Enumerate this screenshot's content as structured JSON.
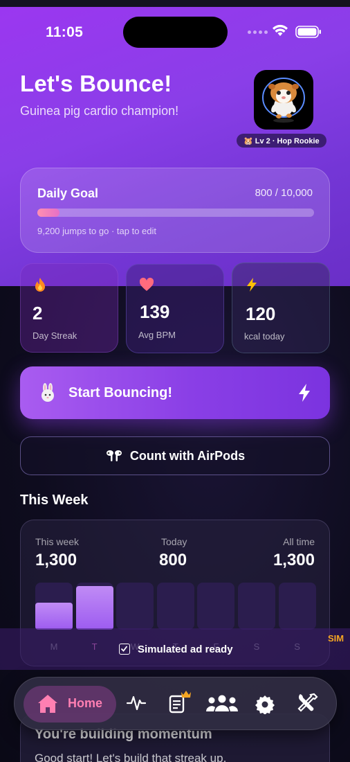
{
  "status_bar": {
    "time": "11:05"
  },
  "hero": {
    "title": "Let's Bounce!",
    "subtitle": "Guinea pig cardio champion!",
    "level_badge": "🐹 Lv 2 · Hop Rookie"
  },
  "daily_goal": {
    "label": "Daily Goal",
    "value": "800 / 10,000",
    "progress": 0.08,
    "hint": "9,200 jumps to go · tap to edit"
  },
  "stats": [
    {
      "value": "2",
      "label": "Day Streak",
      "icon": "flame-icon"
    },
    {
      "value": "139",
      "label": "Avg BPM",
      "icon": "heart-icon"
    },
    {
      "value": "120",
      "label": "kcal today",
      "icon": "bolt-icon"
    }
  ],
  "start_button": {
    "label": "Start Bouncing!"
  },
  "airpods_button": {
    "label": "Count with AirPods"
  },
  "this_week": {
    "section_title": "This Week",
    "stats": [
      {
        "label": "This week",
        "value": "1,300"
      },
      {
        "label": "Today",
        "value": "800"
      },
      {
        "label": "All time",
        "value": "1,300"
      }
    ],
    "days": [
      "M",
      "T",
      "W",
      "T",
      "F",
      "S",
      "S"
    ],
    "today_index": 1,
    "bar_fraction": [
      0.58,
      0.92,
      0,
      0,
      0,
      0,
      0
    ]
  },
  "ad": {
    "text": "Simulated ad ready",
    "tag": "SIM"
  },
  "momentum": {
    "title": "You're building momentum",
    "text": "Good start! Let's build that streak up."
  },
  "tab_bar": {
    "home_label": "Home"
  },
  "colors": {
    "accent": "#8a3ee8",
    "home_tab_text": "#ff7fb2",
    "sim_tag": "#f5a623"
  }
}
